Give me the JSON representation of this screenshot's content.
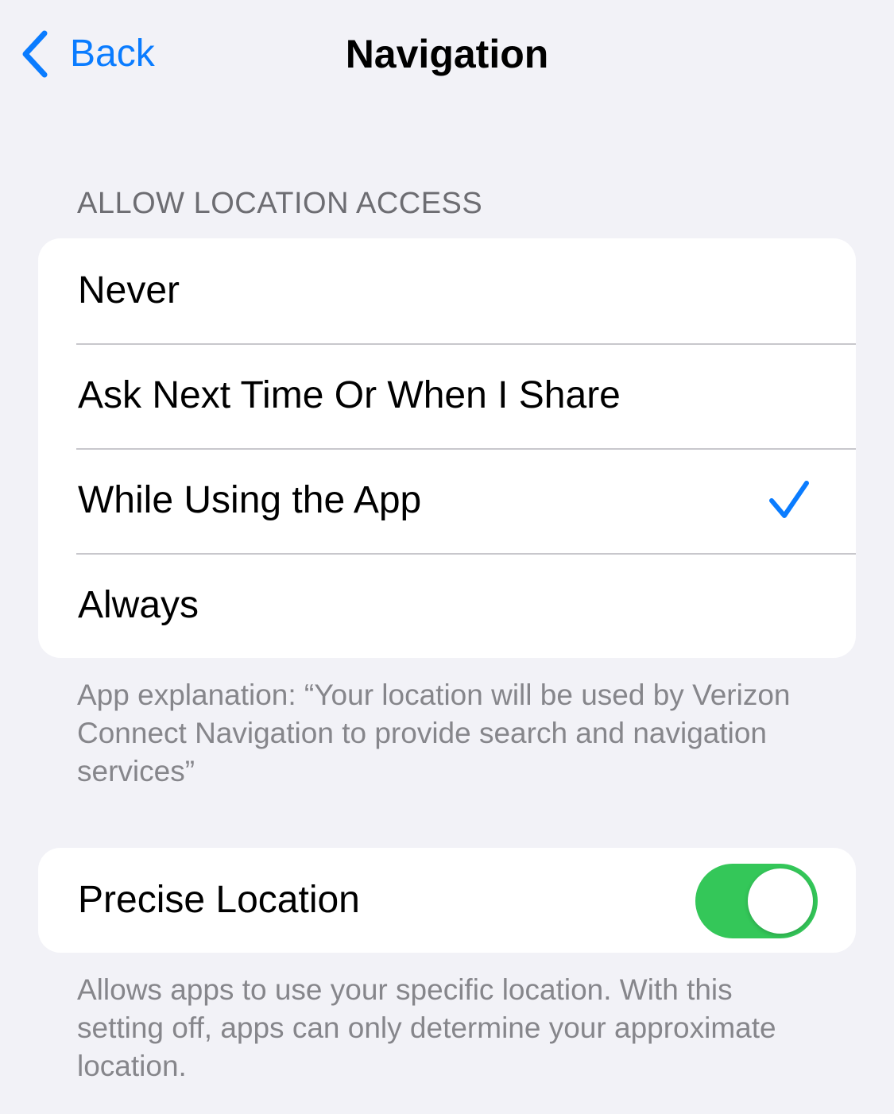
{
  "nav": {
    "back_label": "Back",
    "title": "Navigation",
    "back_icon": "chevron-left-icon"
  },
  "location_access": {
    "header": "ALLOW LOCATION ACCESS",
    "options": [
      {
        "label": "Never",
        "selected": false
      },
      {
        "label": "Ask Next Time Or When I Share",
        "selected": false
      },
      {
        "label": "While Using the App",
        "selected": true
      },
      {
        "label": "Always",
        "selected": false
      }
    ],
    "selected_icon": "checkmark-icon",
    "explanation": "App explanation: “Your location will be used by Verizon Connect Navigation to provide search and navigation services”"
  },
  "precise_location": {
    "label": "Precise Location",
    "enabled": true,
    "footer": "Allows apps to use your specific location. With this setting off, apps can only determine your approximate location."
  },
  "colors": {
    "background": "#f2f2f7",
    "accent_blue": "#0a7cff",
    "toggle_on": "#34c759",
    "secondary_text": "#86868b",
    "header_text": "#6d6d72"
  }
}
